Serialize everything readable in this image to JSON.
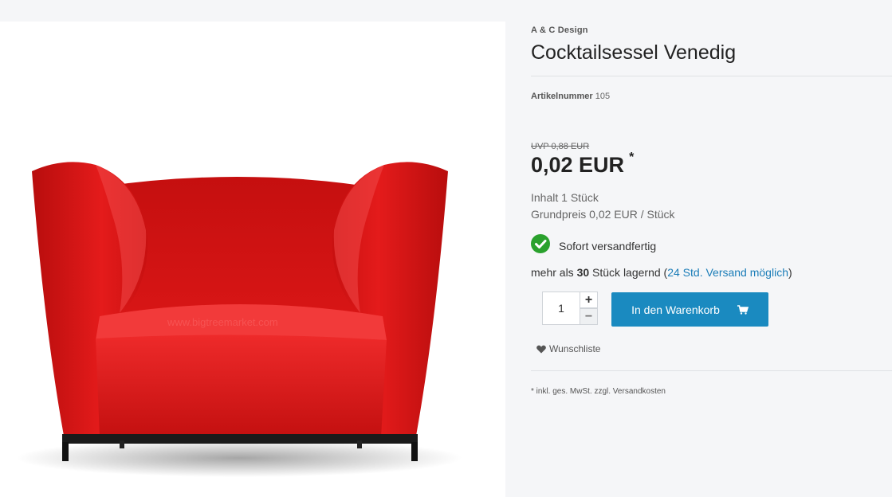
{
  "product": {
    "manufacturer": "A & C Design",
    "title": "Cocktailsessel Venedig",
    "sku_label": "Artikelnummer",
    "sku_value": "105",
    "uvp": "UVP 0,88 EUR",
    "price": "0,02 EUR",
    "price_marker": "*",
    "content_line": "Inhalt 1 Stück",
    "base_price": "Grundpreis 0,02 EUR / Stück",
    "delivery_status": "Sofort versandfertig",
    "stock_prefix": "mehr als ",
    "stock_count": "30",
    "stock_suffix": " Stück lagernd (",
    "stock_link": "24 Std. Versand möglich",
    "stock_close": ")",
    "image_watermark": "www.bigtreemarket.com"
  },
  "buy_box": {
    "quantity_value": "1",
    "plus_label": "+",
    "minus_label": "−",
    "cart_label": "In den Warenkorb"
  },
  "wishlist_label": "Wunschliste",
  "tax_note": "* inkl. ges. MwSt. zzgl. Versandkosten",
  "colors": {
    "accent": "#1a8ac0",
    "success": "#2aa12d",
    "chair_red": "#d81414",
    "link": "#1b7db8"
  },
  "icons": {
    "delivery": "check-circle-icon",
    "cart": "shopping-cart-icon",
    "wishlist": "heart-icon"
  }
}
